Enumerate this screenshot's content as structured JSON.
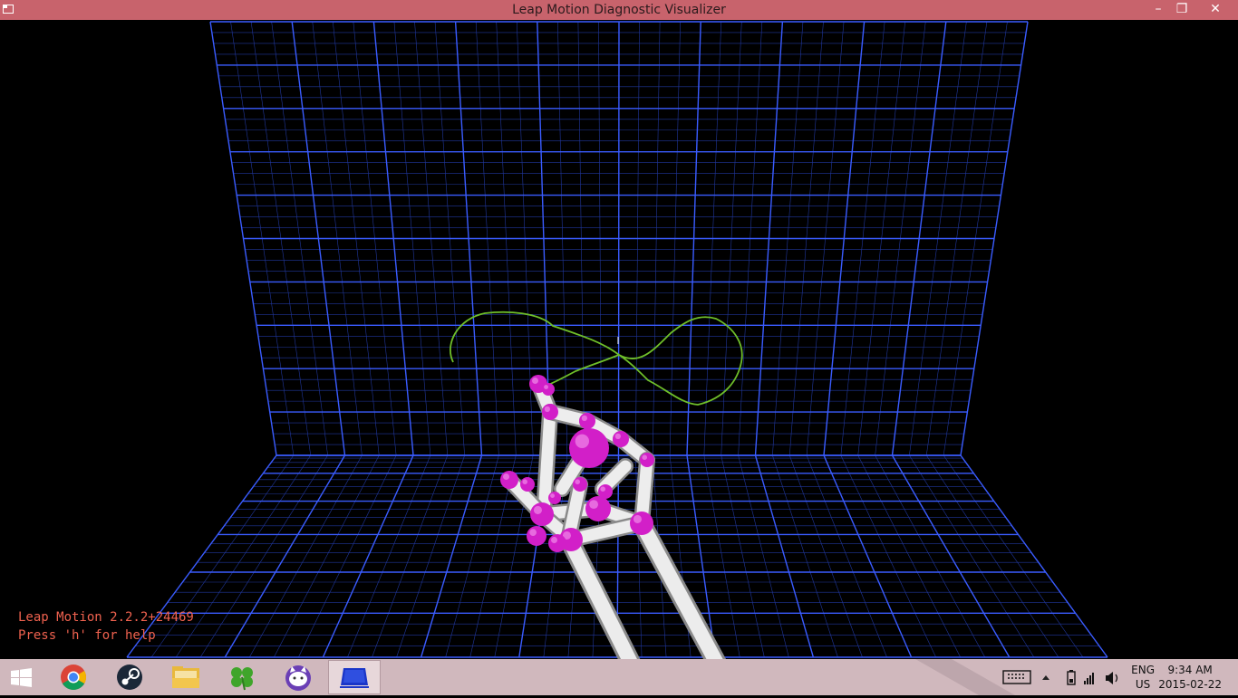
{
  "window": {
    "title": "Leap Motion Diagnostic Visualizer",
    "minimize_glyph": "–",
    "restore_glyph": "❐",
    "close_glyph": "✕"
  },
  "overlay": {
    "version": "Leap Motion 2.2.2+24469",
    "help": "Press 'h' for help"
  },
  "colors": {
    "titlebar": "#c8636c",
    "grid": "#2f4fe0",
    "trail": "#6fbf2a",
    "joint": "#d21fc8",
    "bone": "#e6e6e6",
    "overlay_text": "#f0624f",
    "taskbar": "#d0b8bd"
  },
  "taskbar": {
    "apps": [
      {
        "name": "start",
        "icon": "windows-logo-icon"
      },
      {
        "name": "chrome",
        "icon": "chrome-icon"
      },
      {
        "name": "steam",
        "icon": "steam-icon"
      },
      {
        "name": "file-explorer",
        "icon": "folder-icon"
      },
      {
        "name": "clover",
        "icon": "clover-icon"
      },
      {
        "name": "cat-app",
        "icon": "cat-icon"
      },
      {
        "name": "leap-visualizer",
        "icon": "leap-visualizer-icon",
        "active": true
      }
    ],
    "tray": {
      "lang_line1": "ENG",
      "lang_line2": "US",
      "time": "9:34 AM",
      "date": "2015-02-22",
      "icons": [
        "keyboard-icon",
        "chevron-up-icon",
        "battery-icon",
        "signal-icon",
        "volume-icon"
      ]
    }
  }
}
